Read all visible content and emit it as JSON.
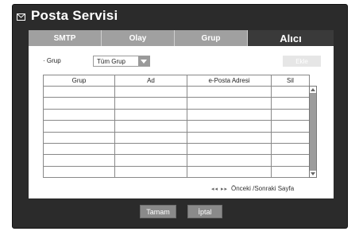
{
  "window": {
    "title": "Posta Servisi",
    "icon": "mail-icon"
  },
  "tabs": [
    {
      "label": "SMTP",
      "active": false
    },
    {
      "label": "Olay",
      "active": false
    },
    {
      "label": "Grup",
      "active": false
    },
    {
      "label": "Alıcı",
      "active": true
    }
  ],
  "filter": {
    "label": "· Grup",
    "selected": "Tüm Grup"
  },
  "add_button": {
    "label": "Ekle"
  },
  "table": {
    "columns": [
      "Grup",
      "Ad",
      "e-Posta Adresi",
      "Sil"
    ],
    "rows": [
      [
        "",
        "",
        "",
        ""
      ],
      [
        "",
        "",
        "",
        ""
      ],
      [
        "",
        "",
        "",
        ""
      ],
      [
        "",
        "",
        "",
        ""
      ],
      [
        "",
        "",
        "",
        ""
      ],
      [
        "",
        "",
        "",
        ""
      ],
      [
        "",
        "",
        "",
        ""
      ],
      [
        "",
        "",
        "",
        ""
      ]
    ]
  },
  "pager": {
    "arrows": "◂◂ ▸▸",
    "label": "Önceki /Sonraki Sayfa"
  },
  "buttons": {
    "ok": "Tamam",
    "cancel": "İptal"
  },
  "colors": {
    "frame": "#2b2b2b",
    "tab_inactive": "#a0a0a0",
    "tab_active": "#3a3a3a",
    "button": "#8a8a8a"
  }
}
